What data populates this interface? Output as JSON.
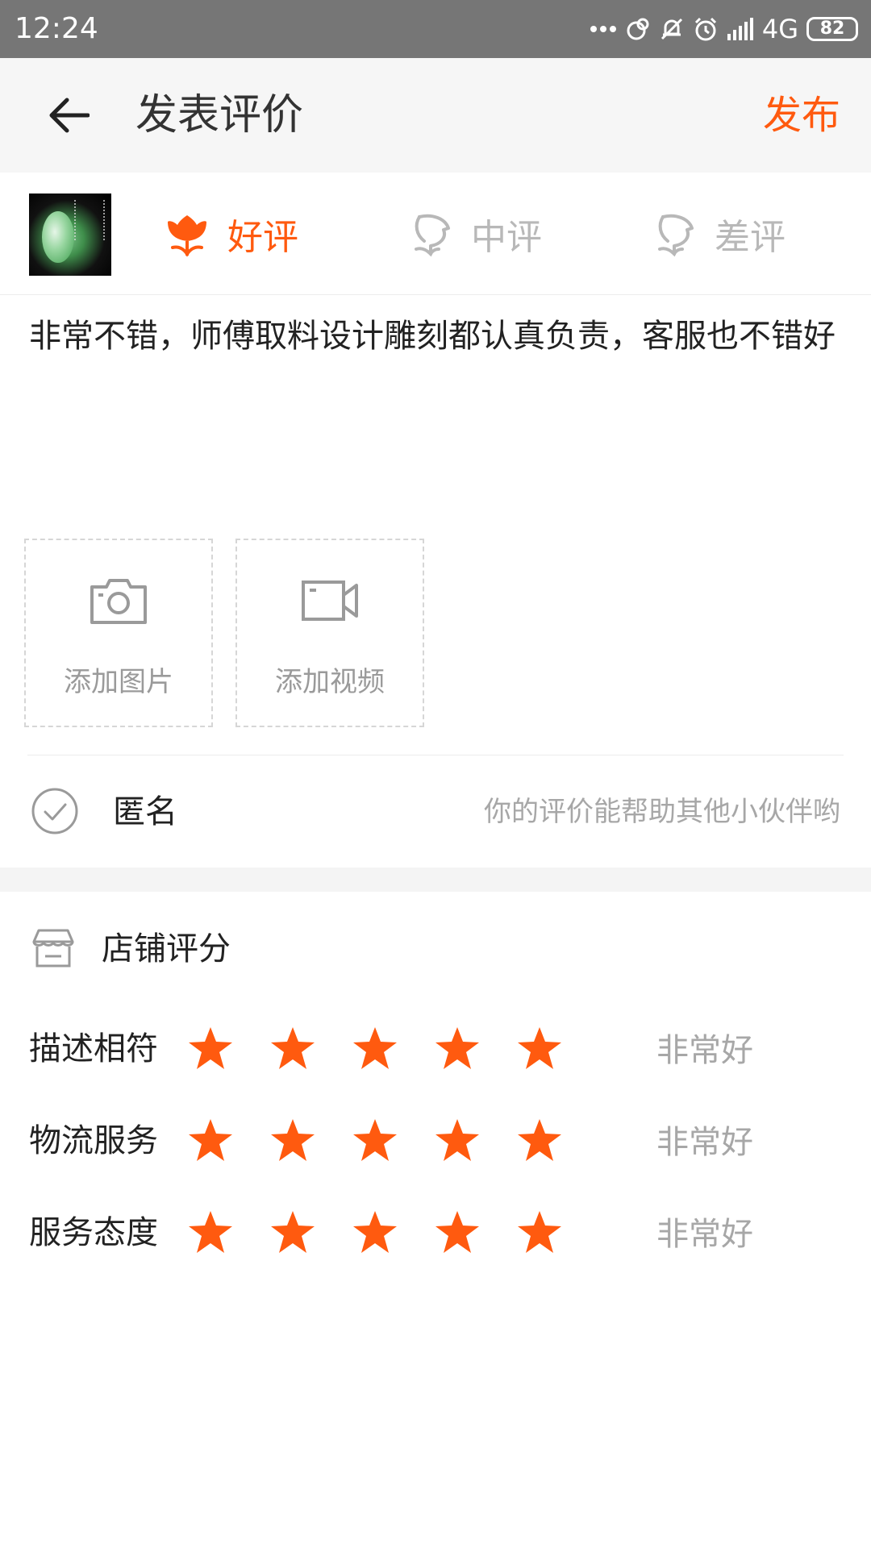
{
  "status_bar": {
    "time": "12:24",
    "network": "4G",
    "battery": "82"
  },
  "header": {
    "title": "发表评价",
    "publish_label": "发布"
  },
  "rating_options": [
    {
      "label": "好评",
      "selected": true,
      "icon": "flower-icon"
    },
    {
      "label": "中评",
      "selected": false,
      "icon": "flower-outline-icon"
    },
    {
      "label": "差评",
      "selected": false,
      "icon": "flower-outline-icon"
    }
  ],
  "review": {
    "text": "非常不错，师傅取料设计雕刻都认真负责，客服也不错好"
  },
  "media": {
    "add_photo_label": "添加图片",
    "add_video_label": "添加视频"
  },
  "anonymous": {
    "label": "匿名",
    "hint": "你的评价能帮助其他小伙伴哟"
  },
  "shop_rating": {
    "title": "店铺评分",
    "rows": [
      {
        "label": "描述相符",
        "stars": 5,
        "max": 5,
        "desc": "非常好"
      },
      {
        "label": "物流服务",
        "stars": 5,
        "max": 5,
        "desc": "非常好"
      },
      {
        "label": "服务态度",
        "stars": 5,
        "max": 5,
        "desc": "非常好"
      }
    ]
  },
  "colors": {
    "accent": "#ff5a0f",
    "muted": "#a7a7a7",
    "status_bar": "#767676"
  }
}
